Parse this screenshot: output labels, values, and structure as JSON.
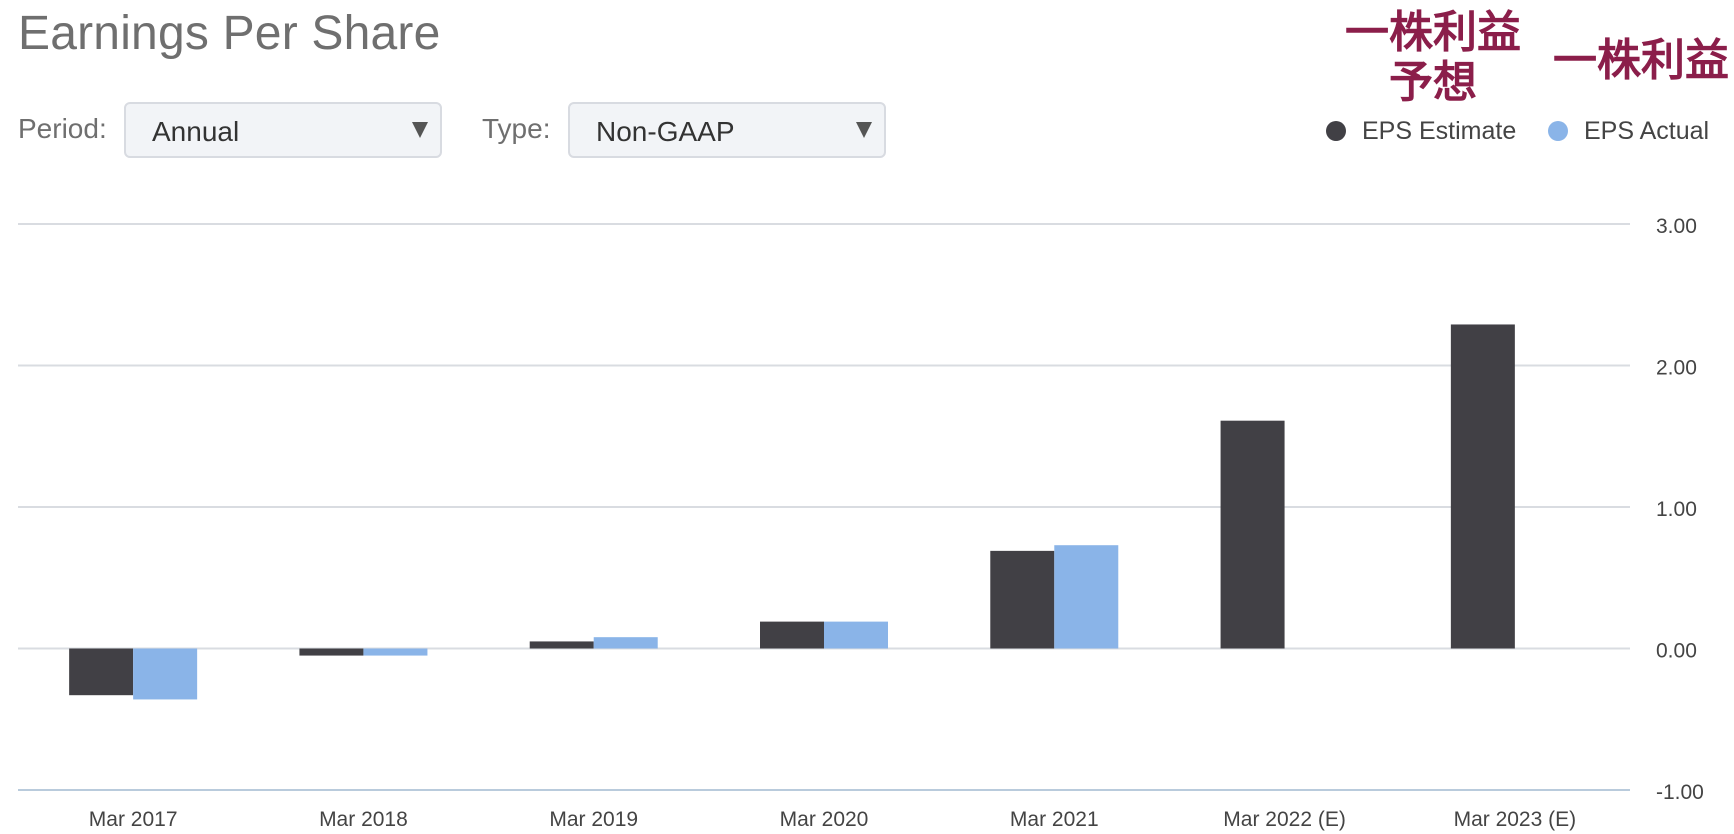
{
  "header": {
    "title": "Earnings Per Share"
  },
  "controls": {
    "period_label": "Period:",
    "period_value": "Annual",
    "type_label": "Type:",
    "type_value": "Non-GAAP"
  },
  "annotations": {
    "estimate_jp": "一株利益\n予想",
    "actual_jp": "一株利益"
  },
  "legend": {
    "estimate": "EPS Estimate",
    "actual": "EPS Actual"
  },
  "colors": {
    "estimate": "#414045",
    "actual": "#8ab4e8",
    "annotation": "#8b1e4a"
  },
  "chart_data": {
    "type": "bar",
    "categories": [
      "Mar 2017",
      "Mar 2018",
      "Mar 2019",
      "Mar 2020",
      "Mar 2021",
      "Mar 2022 (E)",
      "Mar 2023 (E)"
    ],
    "series": [
      {
        "name": "EPS Estimate",
        "values": [
          -0.33,
          -0.05,
          0.05,
          0.19,
          0.69,
          1.61,
          2.29
        ]
      },
      {
        "name": "EPS Actual",
        "values": [
          -0.36,
          -0.05,
          0.08,
          0.19,
          0.73,
          null,
          null
        ]
      }
    ],
    "y_ticks": [
      "3.00",
      "2.00",
      "1.00",
      "0.00",
      "-1.00"
    ],
    "ylim": [
      -1,
      3
    ],
    "grid": true,
    "legend_position": "top-right"
  }
}
